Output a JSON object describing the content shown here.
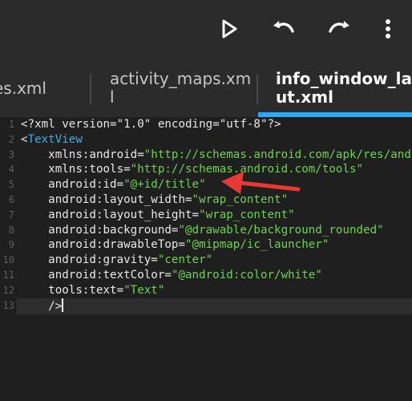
{
  "toolbar": {
    "icons": [
      "play-icon",
      "undo-icon",
      "redo-icon",
      "more-vert-icon"
    ]
  },
  "tabs": [
    {
      "label": "es.xml",
      "active": false
    },
    {
      "label": "activity_maps.xm\nl",
      "active": false
    },
    {
      "label": "info_window_layo\nut.xml",
      "active": true
    }
  ],
  "editor": {
    "line_numbers": [
      "1",
      "2",
      "3",
      "4",
      "5",
      "6",
      "7",
      "8",
      "9",
      "10",
      "11",
      "12",
      "13"
    ],
    "lines": [
      {
        "parts": [
          {
            "t": "plain",
            "v": "<?xml version=\"1.0\" encoding=\"utf-8\"?>"
          }
        ]
      },
      {
        "parts": [
          {
            "t": "plain",
            "v": "<"
          },
          {
            "t": "tag",
            "v": "TextView"
          }
        ]
      },
      {
        "parts": [
          {
            "t": "attr",
            "v": "    xmlns:android"
          },
          {
            "t": "eq",
            "v": "="
          },
          {
            "t": "str",
            "v": "\"http://schemas.android.com/apk/res/and"
          }
        ]
      },
      {
        "parts": [
          {
            "t": "attr",
            "v": "    xmlns:tools"
          },
          {
            "t": "eq",
            "v": "="
          },
          {
            "t": "str",
            "v": "\"http://schemas.android.com/tools\""
          }
        ]
      },
      {
        "parts": [
          {
            "t": "attr",
            "v": "    android:id"
          },
          {
            "t": "eq",
            "v": "="
          },
          {
            "t": "str",
            "v": "\"@+id/title\""
          }
        ]
      },
      {
        "parts": [
          {
            "t": "attr",
            "v": "    android:layout_width"
          },
          {
            "t": "eq",
            "v": "="
          },
          {
            "t": "str",
            "v": "\"wrap_content\""
          }
        ]
      },
      {
        "parts": [
          {
            "t": "attr",
            "v": "    android:layout_height"
          },
          {
            "t": "eq",
            "v": "="
          },
          {
            "t": "str",
            "v": "\"wrap_content\""
          }
        ]
      },
      {
        "parts": [
          {
            "t": "attr",
            "v": "    android:background"
          },
          {
            "t": "eq",
            "v": "="
          },
          {
            "t": "str",
            "v": "\"@drawable/background_rounded\""
          }
        ]
      },
      {
        "parts": [
          {
            "t": "attr",
            "v": "    android:drawableTop"
          },
          {
            "t": "eq",
            "v": "="
          },
          {
            "t": "str",
            "v": "\"@mipmap/ic_launcher\""
          }
        ]
      },
      {
        "parts": [
          {
            "t": "attr",
            "v": "    android:gravity"
          },
          {
            "t": "eq",
            "v": "="
          },
          {
            "t": "str",
            "v": "\"center\""
          }
        ]
      },
      {
        "parts": [
          {
            "t": "attr",
            "v": "    android:textColor"
          },
          {
            "t": "eq",
            "v": "="
          },
          {
            "t": "str",
            "v": "\"@android:color/white\""
          }
        ]
      },
      {
        "parts": [
          {
            "t": "attr",
            "v": "    tools:text"
          },
          {
            "t": "eq",
            "v": "="
          },
          {
            "t": "str",
            "v": "\"Text\""
          }
        ]
      },
      {
        "parts": [
          {
            "t": "plain",
            "v": "    />"
          }
        ]
      }
    ],
    "current_line": 13
  },
  "colors": {
    "accent": "#2ea8f2",
    "string": "#6fd24c",
    "tag": "#3ab0e0",
    "annotation_arrow": "#e53935"
  }
}
